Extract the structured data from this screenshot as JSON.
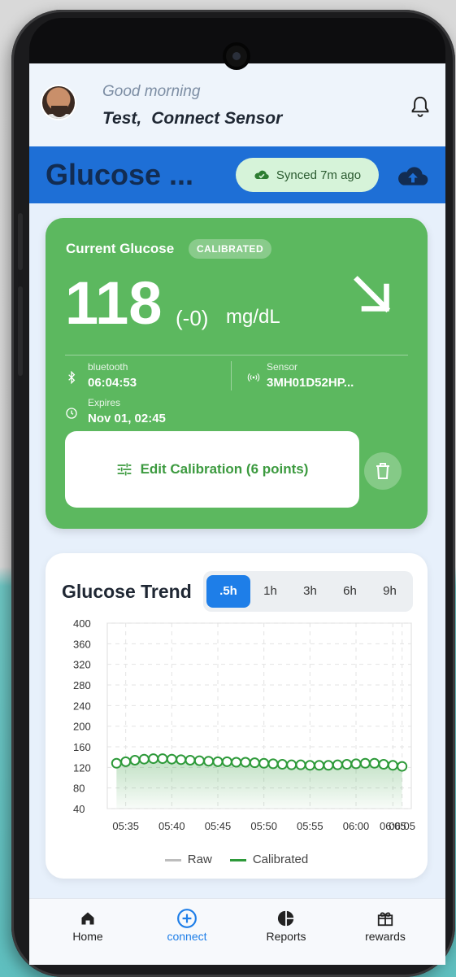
{
  "header": {
    "greeting": "Good morning",
    "user_name": "Test,",
    "action_link": "Connect Sensor"
  },
  "status_bar": {
    "title": "Glucose ...",
    "sync_text": "Synced 7m ago"
  },
  "glucose_card": {
    "title": "Current Glucose",
    "badge": "CALIBRATED",
    "value": "118",
    "delta": "(-0)",
    "unit": "mg/dL",
    "trend": "falling",
    "bluetooth_label": "bluetooth",
    "bluetooth_time": "06:04:53",
    "sensor_label": "Sensor",
    "sensor_id": "3MH01D52HP...",
    "expires_label": "Expires",
    "expires_value": "Nov 01, 02:45",
    "calibration_button": "Edit Calibration (6 points)"
  },
  "trend_card": {
    "title": "Glucose Trend",
    "ranges": [
      ".5h",
      "1h",
      "3h",
      "6h",
      "9h"
    ],
    "active_range": ".5h"
  },
  "chart_data": {
    "type": "line",
    "ylim": [
      40,
      400
    ],
    "y_ticks": [
      "400",
      "360",
      "320",
      "280",
      "240",
      "200",
      "160",
      "120",
      "80",
      "40"
    ],
    "x_ticks": [
      "05:35",
      "05:40",
      "05:45",
      "05:50",
      "05:55",
      "06:00",
      "06:05",
      "06:05"
    ],
    "legend": [
      "Raw",
      "Calibrated"
    ],
    "series": [
      {
        "name": "Calibrated",
        "color": "#2e9a3a",
        "x": [
          "05:34",
          "05:35",
          "05:36",
          "05:37",
          "05:38",
          "05:39",
          "05:40",
          "05:41",
          "05:42",
          "05:43",
          "05:44",
          "05:45",
          "05:46",
          "05:47",
          "05:48",
          "05:49",
          "05:50",
          "05:51",
          "05:52",
          "05:53",
          "05:54",
          "05:55",
          "05:56",
          "05:57",
          "05:58",
          "05:59",
          "06:00",
          "06:01",
          "06:02",
          "06:03",
          "06:04",
          "06:05"
        ],
        "values": [
          128,
          131,
          134,
          136,
          137,
          137,
          136,
          135,
          134,
          133,
          132,
          131,
          131,
          130,
          130,
          129,
          128,
          127,
          126,
          125,
          125,
          124,
          124,
          124,
          125,
          126,
          127,
          128,
          128,
          126,
          124,
          122
        ]
      },
      {
        "name": "Raw",
        "color": "#bdbdbd",
        "x": [],
        "values": []
      }
    ]
  },
  "nav": {
    "items": [
      {
        "label": "Home",
        "icon": "home-icon"
      },
      {
        "label": "connect",
        "icon": "plus-circle-icon"
      },
      {
        "label": "Reports",
        "icon": "pie-chart-icon"
      },
      {
        "label": "rewards",
        "icon": "gift-icon"
      }
    ],
    "active": "connect"
  },
  "colors": {
    "brand_blue": "#1e6fd6",
    "card_green": "#5cb85f",
    "active_blue": "#1e7ee8"
  }
}
